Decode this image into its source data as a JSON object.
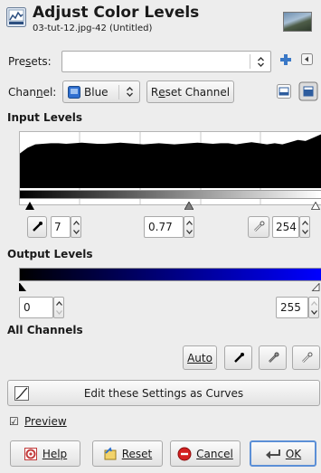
{
  "header": {
    "title": "Adjust Color Levels",
    "subtitle": "03-tut-12.jpg-42 (Untitled)"
  },
  "presets": {
    "label_pre": "Pre",
    "label_u": "s",
    "label_post": "ets:",
    "value": ""
  },
  "channel": {
    "label_pre": "Chan",
    "label_u": "n",
    "label_post": "el:",
    "selected": "Blue",
    "reset_pre": "R",
    "reset_u": "e",
    "reset_post": "set Channel"
  },
  "input_levels": {
    "heading": "Input Levels",
    "low": "7",
    "gamma": "0.77",
    "high": "254"
  },
  "output_levels": {
    "heading": "Output Levels",
    "low": "0",
    "high": "255"
  },
  "all_channels": {
    "heading": "All Channels",
    "auto_label": "Auto"
  },
  "curves_button": "Edit these Settings as Curves",
  "preview": {
    "label": "Preview",
    "checked": true
  },
  "footer": {
    "help": "Help",
    "reset": "Reset",
    "cancel": "Cancel",
    "ok": "OK"
  },
  "colors": {
    "output_gradient_start": "#000000",
    "output_gradient_end": "#0000ff",
    "ok_border": "#5b8fd6"
  },
  "histogram_profile": [
    0.62,
    0.72,
    0.78,
    0.79,
    0.8,
    0.8,
    0.79,
    0.8,
    0.81,
    0.8,
    0.79,
    0.79,
    0.8,
    0.81,
    0.8,
    0.79,
    0.78,
    0.79,
    0.8,
    0.79,
    0.78,
    0.79,
    0.8,
    0.81,
    0.8,
    0.79,
    0.8,
    0.8,
    0.78,
    0.8,
    0.82,
    0.8,
    0.78,
    0.8,
    0.78,
    0.82,
    0.86,
    0.84,
    0.9,
    0.96
  ]
}
